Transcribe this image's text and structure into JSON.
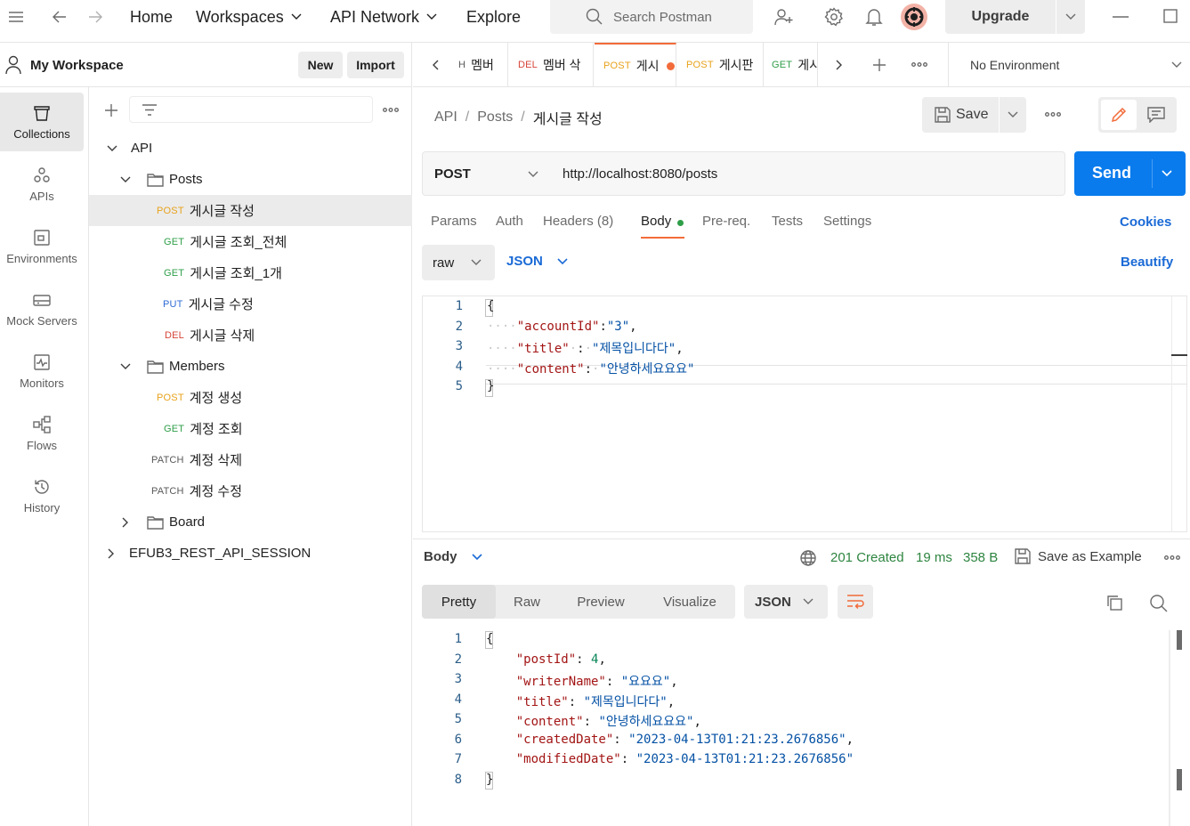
{
  "topbar": {
    "nav": [
      "Home",
      "Workspaces",
      "API Network",
      "Explore"
    ],
    "search_placeholder": "Search Postman",
    "upgrade_label": "Upgrade"
  },
  "workspace": {
    "title": "My Workspace",
    "new_label": "New",
    "import_label": "Import"
  },
  "rail": [
    "Collections",
    "APIs",
    "Environments",
    "Mock Servers",
    "Monitors",
    "Flows",
    "History"
  ],
  "tree": {
    "root": "API",
    "folders": {
      "posts": "Posts",
      "members": "Members",
      "board": "Board"
    },
    "posts_items": [
      {
        "method": "POST",
        "name": "게시글 작성"
      },
      {
        "method": "GET",
        "name": "게시글 조회_전체"
      },
      {
        "method": "GET",
        "name": "게시글 조회_1개"
      },
      {
        "method": "PUT",
        "name": "게시글 수정"
      },
      {
        "method": "DEL",
        "name": "게시글 삭제"
      }
    ],
    "members_items": [
      {
        "method": "POST",
        "name": "계정 생성"
      },
      {
        "method": "GET",
        "name": "계정 조회"
      },
      {
        "method": "PATCH",
        "name": "계정 삭제"
      },
      {
        "method": "PATCH",
        "name": "계정 수정"
      }
    ],
    "other_collection": "EFUB3_REST_API_SESSION"
  },
  "tabs": [
    {
      "method": "H",
      "name": "멤버"
    },
    {
      "method": "DEL",
      "name": "멤버 삭"
    },
    {
      "method": "POST",
      "name": "게시"
    },
    {
      "method": "POST",
      "name": "게시판"
    },
    {
      "method": "GET",
      "name": "게시"
    }
  ],
  "environment": "No Environment",
  "breadcrumb": [
    "API",
    "Posts",
    "게시글 작성"
  ],
  "save_label": "Save",
  "request": {
    "method": "POST",
    "url": "http://localhost:8080/posts",
    "send_label": "Send",
    "tabs": [
      "Params",
      "Auth",
      "Headers (8)",
      "Body",
      "Pre-req.",
      "Tests",
      "Settings"
    ],
    "cookies_label": "Cookies",
    "body_mode": "raw",
    "body_lang": "JSON",
    "beautify_label": "Beautify",
    "body_lines": [
      {
        "n": "1",
        "parts": [
          [
            "p",
            "{"
          ]
        ]
      },
      {
        "n": "2",
        "parts": [
          [
            "dot",
            "····"
          ],
          [
            "k",
            "\"accountId\""
          ],
          [
            "p",
            ":"
          ],
          [
            "s",
            "\"3\""
          ],
          [
            "p",
            ","
          ]
        ]
      },
      {
        "n": "3",
        "parts": [
          [
            "dot",
            "····"
          ],
          [
            "k",
            "\"title\""
          ],
          [
            "dot",
            "·"
          ],
          [
            "p",
            ":"
          ],
          [
            "dot",
            "·"
          ],
          [
            "s",
            "\"제목입니다다\""
          ],
          [
            "p",
            ","
          ]
        ]
      },
      {
        "n": "4",
        "parts": [
          [
            "dot",
            "····"
          ],
          [
            "k",
            "\"content\""
          ],
          [
            "p",
            ":"
          ],
          [
            "dot",
            "·"
          ],
          [
            "s",
            "\"안녕하세요요요\""
          ]
        ]
      },
      {
        "n": "5",
        "parts": [
          [
            "p",
            "}"
          ]
        ]
      }
    ]
  },
  "response": {
    "section_label": "Body",
    "status": "201 Created",
    "time": "19 ms",
    "size": "358 B",
    "save_example_label": "Save as Example",
    "views": [
      "Pretty",
      "Raw",
      "Preview",
      "Visualize"
    ],
    "format": "JSON",
    "lines": [
      {
        "n": "1",
        "parts": [
          [
            "p",
            "{"
          ]
        ]
      },
      {
        "n": "2",
        "parts": [
          [
            "p",
            "    "
          ],
          [
            "k",
            "\"postId\""
          ],
          [
            "p",
            ": "
          ],
          [
            "n",
            "4"
          ],
          [
            "p",
            ","
          ]
        ]
      },
      {
        "n": "3",
        "parts": [
          [
            "p",
            "    "
          ],
          [
            "k",
            "\"writerName\""
          ],
          [
            "p",
            ": "
          ],
          [
            "s",
            "\"요요요\""
          ],
          [
            "p",
            ","
          ]
        ]
      },
      {
        "n": "4",
        "parts": [
          [
            "p",
            "    "
          ],
          [
            "k",
            "\"title\""
          ],
          [
            "p",
            ": "
          ],
          [
            "s",
            "\"제목입니다다\""
          ],
          [
            "p",
            ","
          ]
        ]
      },
      {
        "n": "5",
        "parts": [
          [
            "p",
            "    "
          ],
          [
            "k",
            "\"content\""
          ],
          [
            "p",
            ": "
          ],
          [
            "s",
            "\"안녕하세요요요\""
          ],
          [
            "p",
            ","
          ]
        ]
      },
      {
        "n": "6",
        "parts": [
          [
            "p",
            "    "
          ],
          [
            "k",
            "\"createdDate\""
          ],
          [
            "p",
            ": "
          ],
          [
            "s",
            "\"2023-04-13T01:21:23.2676856\""
          ],
          [
            "p",
            ","
          ]
        ]
      },
      {
        "n": "7",
        "parts": [
          [
            "p",
            "    "
          ],
          [
            "k",
            "\"modifiedDate\""
          ],
          [
            "p",
            ": "
          ],
          [
            "s",
            "\"2023-04-13T01:21:23.2676856\""
          ]
        ]
      },
      {
        "n": "8",
        "parts": [
          [
            "p",
            "}"
          ]
        ]
      }
    ]
  },
  "colors": {
    "accent": "#f26b3a",
    "send": "#097bed",
    "post": "#e8a21b",
    "get": "#2e9e48",
    "put": "#2f6bd6",
    "del": "#d6453a",
    "status_ok": "#2e8540"
  }
}
